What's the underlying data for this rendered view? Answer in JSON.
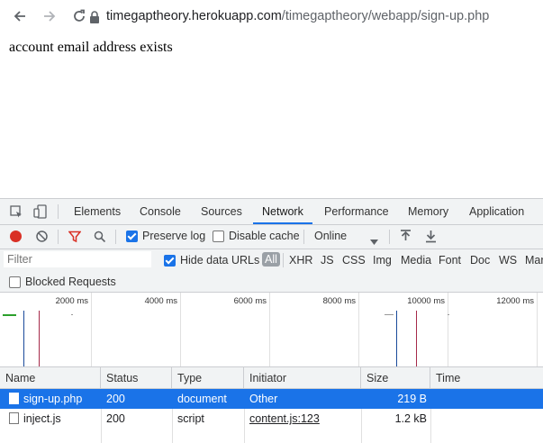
{
  "browser": {
    "url_host": "timegaptheory.herokuapp.com",
    "url_path": "/timegaptheory/webapp/sign-up.php"
  },
  "page": {
    "message": "account email address exists"
  },
  "devtools": {
    "tabs": [
      "Elements",
      "Console",
      "Sources",
      "Network",
      "Performance",
      "Memory",
      "Application"
    ],
    "active_tab": "Network",
    "network_toolbar": {
      "preserve_log_label": "Preserve log",
      "preserve_log_checked": true,
      "disable_cache_label": "Disable cache",
      "disable_cache_checked": false,
      "throttle_value": "Online"
    },
    "filter": {
      "placeholder": "Filter",
      "hide_data_urls_label": "Hide data URLs",
      "hide_data_urls_checked": true,
      "types": [
        "All",
        "XHR",
        "JS",
        "CSS",
        "Img",
        "Media",
        "Font",
        "Doc",
        "WS",
        "Mar"
      ],
      "active_type": "All"
    },
    "blocked_requests_label": "Blocked Requests",
    "timeline_ticks": [
      "2000 ms",
      "4000 ms",
      "6000 ms",
      "8000 ms",
      "10000 ms",
      "12000 ms"
    ],
    "columns": [
      "Name",
      "Status",
      "Type",
      "Initiator",
      "Size",
      "Time"
    ],
    "rows": [
      {
        "name": "sign-up.php",
        "status": "200",
        "type": "document",
        "initiator": "Other",
        "size": "219 B",
        "time": "",
        "selected": true
      },
      {
        "name": "inject.js",
        "status": "200",
        "type": "script",
        "initiator": "content.js:123",
        "size": "1.2 kB",
        "time": "",
        "selected": false
      }
    ],
    "colors": {
      "accent": "#1a73e8",
      "record": "#d93025",
      "filter_icon": "#d93025"
    }
  }
}
